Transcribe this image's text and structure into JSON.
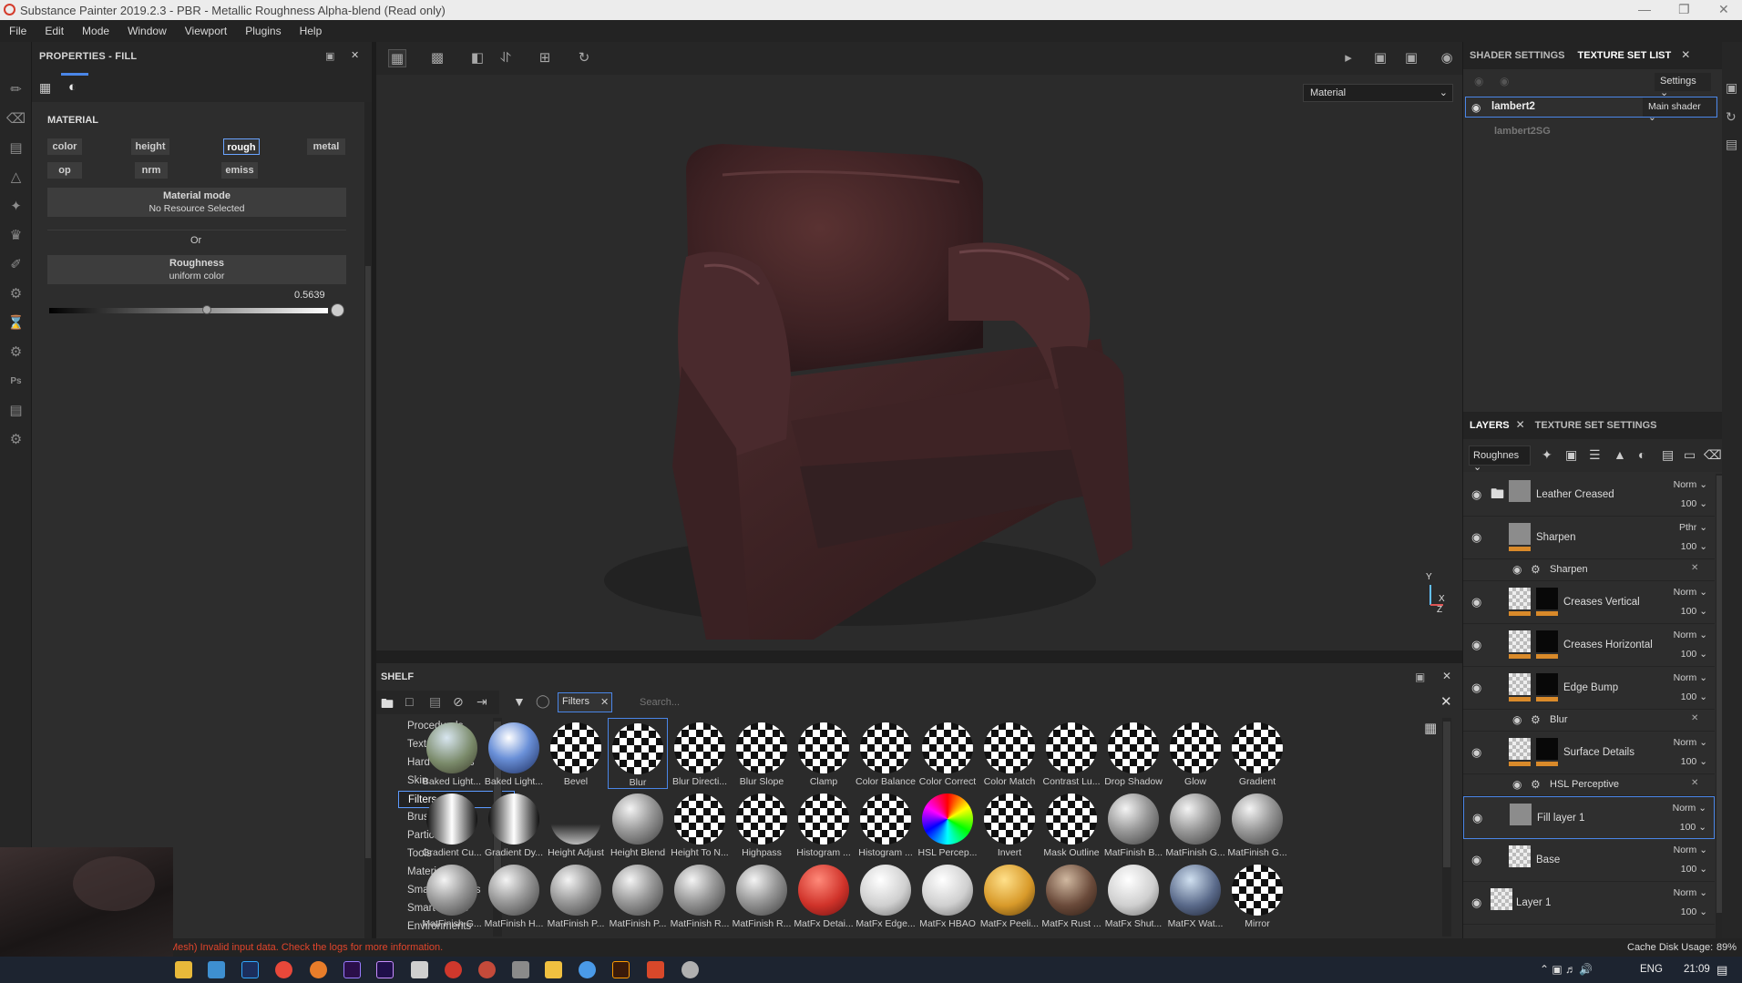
{
  "window": {
    "title": "Substance Painter 2019.2.3 - PBR - Metallic Roughness Alpha-blend (Read only)"
  },
  "menu": [
    "File",
    "Edit",
    "Mode",
    "Window",
    "Viewport",
    "Plugins",
    "Help"
  ],
  "properties": {
    "title": "PROPERTIES - FILL",
    "section": "MATERIAL",
    "channels": [
      "color",
      "height",
      "rough",
      "metal",
      "op",
      "nrm",
      "emiss"
    ],
    "selected_channel": "rough",
    "material_mode": {
      "title": "Material mode",
      "sub": "No Resource Selected"
    },
    "or_label": "Or",
    "roughness": {
      "title": "Roughness",
      "sub": "uniform color",
      "value": "0.5639",
      "slider_fraction": 0.5639
    }
  },
  "viewport": {
    "mode_select": "Material",
    "axis_labels": {
      "y": "Y",
      "x": "X",
      "z": "Z"
    }
  },
  "shelf": {
    "title": "SHELF",
    "filter_tag": "Filters",
    "search_placeholder": "Search...",
    "categories": [
      "Procedurals",
      "Textures",
      "Hard Surfaces",
      "Skin",
      "Filters",
      "Brushes",
      "Particles",
      "Tools",
      "Materials",
      "Smart materials",
      "Smart masks",
      "Environments"
    ],
    "selected_category": "Filters",
    "items": [
      {
        "label": "Baked Light...",
        "icon": "sphere-landscape-icon"
      },
      {
        "label": "Baked Light...",
        "icon": "sphere-sky-icon"
      },
      {
        "label": "Bevel",
        "icon": "checker-sphere-icon"
      },
      {
        "label": "Blur",
        "icon": "checker-sphere-icon"
      },
      {
        "label": "Blur Directi...",
        "icon": "checker-sphere-icon"
      },
      {
        "label": "Blur Slope",
        "icon": "checker-sphere-icon"
      },
      {
        "label": "Clamp",
        "icon": "checker-sphere-icon"
      },
      {
        "label": "Color Balance",
        "icon": "checker-sphere-icon"
      },
      {
        "label": "Color Correct",
        "icon": "checker-sphere-icon"
      },
      {
        "label": "Color Match",
        "icon": "checker-sphere-icon"
      },
      {
        "label": "Contrast Lu...",
        "icon": "checker-sphere-icon"
      },
      {
        "label": "Drop Shadow",
        "icon": "checker-sphere-icon"
      },
      {
        "label": "Glow",
        "icon": "checker-sphere-icon"
      },
      {
        "label": "Gradient",
        "icon": "checker-sphere-icon"
      },
      {
        "label": "Gradient Cu...",
        "icon": "gradient-sphere-icon"
      },
      {
        "label": "Gradient Dy...",
        "icon": "gradient-sphere-icon"
      },
      {
        "label": "Height Adjust",
        "icon": "height-adjust-icon"
      },
      {
        "label": "Height Blend",
        "icon": "metal-sphere-icon"
      },
      {
        "label": "Height To N...",
        "icon": "checker-sphere-icon"
      },
      {
        "label": "Highpass",
        "icon": "checker-sphere-icon"
      },
      {
        "label": "Histogram ...",
        "icon": "checker-sphere-icon"
      },
      {
        "label": "Histogram ...",
        "icon": "checker-sphere-icon"
      },
      {
        "label": "HSL Percep...",
        "icon": "rainbow-sphere-icon"
      },
      {
        "label": "Invert",
        "icon": "checker-sphere-icon"
      },
      {
        "label": "Mask Outline",
        "icon": "checker-sphere-icon"
      },
      {
        "label": "MatFinish B...",
        "icon": "metal-sphere-icon"
      },
      {
        "label": "MatFinish G...",
        "icon": "metal-sphere-icon"
      },
      {
        "label": "MatFinish G...",
        "icon": "metal-sphere-icon"
      },
      {
        "label": "MatFinish G...",
        "icon": "metal-sphere-icon"
      },
      {
        "label": "MatFinish H...",
        "icon": "metal-sphere-icon"
      },
      {
        "label": "MatFinish P...",
        "icon": "metal-sphere-icon"
      },
      {
        "label": "MatFinish P...",
        "icon": "metal-sphere-icon"
      },
      {
        "label": "MatFinish R...",
        "icon": "metal-sphere-icon"
      },
      {
        "label": "MatFinish R...",
        "icon": "metal-sphere-icon"
      },
      {
        "label": "MatFx Detai...",
        "icon": "red-sphere-icon"
      },
      {
        "label": "MatFx Edge...",
        "icon": "white-sphere-icon"
      },
      {
        "label": "MatFx HBAO",
        "icon": "white-sphere-icon"
      },
      {
        "label": "MatFx Peeli...",
        "icon": "gold-sphere-icon"
      },
      {
        "label": "MatFx Rust ...",
        "icon": "rust-sphere-icon"
      },
      {
        "label": "MatFx Shut...",
        "icon": "white-sphere-icon"
      },
      {
        "label": "MatFX Wat...",
        "icon": "water-sphere-icon"
      },
      {
        "label": "Mirror",
        "icon": "checker-sphere-icon"
      }
    ],
    "selected_item": "Blur"
  },
  "texture_set": {
    "tabs": [
      "SHADER SETTINGS",
      "TEXTURE SET LIST"
    ],
    "active_tab": "TEXTURE SET LIST",
    "settings_button": "Settings",
    "rows": [
      {
        "name": "lambert2",
        "shader": "Main shader"
      },
      {
        "name": "lambert2SG"
      }
    ]
  },
  "layers": {
    "tabs": [
      "LAYERS",
      "TEXTURE SET SETTINGS"
    ],
    "channel_select": "Roughnes",
    "items": [
      {
        "name": "Leather Creased",
        "blend": "Norm",
        "opacity": "100",
        "type": "folder"
      },
      {
        "name": "Sharpen",
        "blend": "Pthr",
        "opacity": "100",
        "type": "fill"
      },
      {
        "name": "Sharpen",
        "type": "filter"
      },
      {
        "name": "Creases Vertical",
        "blend": "Norm",
        "opacity": "100",
        "type": "mask"
      },
      {
        "name": "Creases Horizontal",
        "blend": "Norm",
        "opacity": "100",
        "type": "mask"
      },
      {
        "name": "Edge Bump",
        "blend": "Norm",
        "opacity": "100",
        "type": "mask"
      },
      {
        "name": "Blur",
        "type": "filter"
      },
      {
        "name": "Surface Details",
        "blend": "Norm",
        "opacity": "100",
        "type": "mask"
      },
      {
        "name": "HSL Perceptive",
        "type": "filter"
      },
      {
        "name": "Fill layer 1",
        "blend": "Norm",
        "opacity": "100",
        "type": "fill"
      },
      {
        "name": "Base",
        "blend": "Norm",
        "opacity": "100",
        "type": "mask"
      },
      {
        "name": "Layer 1",
        "blend": "Norm",
        "opacity": "100",
        "type": "paint"
      }
    ],
    "selected": "Fill layer 1"
  },
  "status": {
    "message": "Mesh) Invalid input data. Check the logs for more information.",
    "cache_label": "Cache Disk Usage:",
    "cache_value": "89%"
  },
  "taskbar": {
    "language": "ENG",
    "time": "21:09"
  },
  "colors": {
    "accent": "#4a86e8",
    "orange": "#d98a2a",
    "error": "#e0452b"
  }
}
